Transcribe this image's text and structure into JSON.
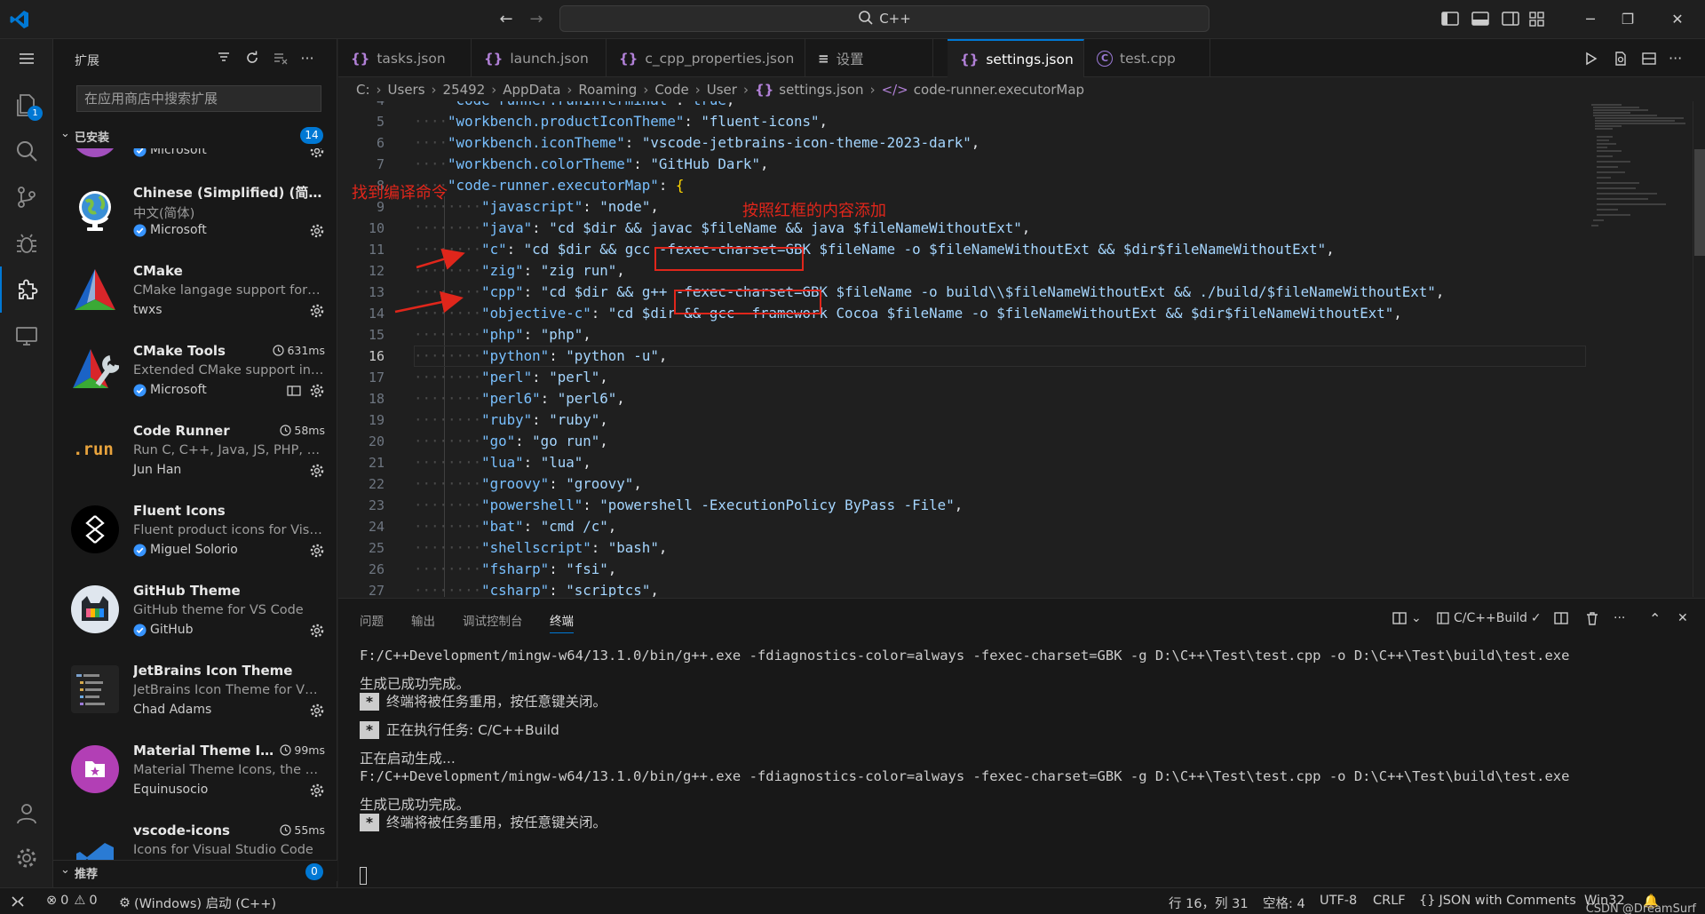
{
  "titlebar": {
    "command_center": "C++"
  },
  "activity": {
    "explorer_badge": "1"
  },
  "sidebar": {
    "title": "扩展",
    "search_placeholder": "在应用商店中搜索扩展",
    "installed_label": "已安装",
    "installed_count": "14",
    "recommended_label": "推荐",
    "recommended_count": "0",
    "extensions": [
      {
        "name": "",
        "desc": "",
        "publisher": "Microsoft",
        "verified": true,
        "time": "",
        "icon": "purple-partial-icon"
      },
      {
        "name": "Chinese (Simplified) (简体中文) Language Pack",
        "desc": "中文(简体)",
        "publisher": "Microsoft",
        "verified": true,
        "time": "",
        "icon": "globe-icon"
      },
      {
        "name": "CMake",
        "desc": "CMake langage support for Visual Studio Code",
        "publisher": "twxs",
        "verified": false,
        "time": "",
        "icon": "cmake-icon"
      },
      {
        "name": "CMake Tools",
        "desc": "Extended CMake support in Visual Studio Code",
        "publisher": "Microsoft",
        "verified": true,
        "time": "631ms",
        "icon": "cmake-tools-icon"
      },
      {
        "name": "Code Runner",
        "desc": "Run C, C++, Java, JS, PHP, Python, Perl, Ruby",
        "publisher": "Jun Han",
        "verified": false,
        "time": "58ms",
        "icon": "run-icon"
      },
      {
        "name": "Fluent Icons",
        "desc": "Fluent product icons for Visual Studio Code",
        "publisher": "Miguel Solorio",
        "verified": true,
        "time": "",
        "icon": "fluent-icon"
      },
      {
        "name": "GitHub Theme",
        "desc": "GitHub theme for VS Code",
        "publisher": "GitHub",
        "verified": true,
        "time": "",
        "icon": "github-theme-icon"
      },
      {
        "name": "JetBrains Icon Theme",
        "desc": "JetBrains Icon Theme for VS Code",
        "publisher": "Chad Adams",
        "verified": false,
        "time": "",
        "icon": "jetbrains-icon"
      },
      {
        "name": "Material Theme Icons",
        "desc": "Material Theme Icons, the most epic icons",
        "publisher": "Equinusocio",
        "verified": false,
        "time": "99ms",
        "icon": "material-icon"
      },
      {
        "name": "vscode-icons",
        "desc": "Icons for Visual Studio Code",
        "publisher": "",
        "verified": false,
        "time": "55ms",
        "icon": "vscode-icons-icon"
      }
    ]
  },
  "tabs": [
    {
      "label": "tasks.json",
      "icon": "{}",
      "active": false
    },
    {
      "label": "launch.json",
      "icon": "{}",
      "active": false
    },
    {
      "label": "c_cpp_properties.json",
      "icon": "{}",
      "active": false
    },
    {
      "label": "设置",
      "icon": "≡",
      "active": false
    },
    {
      "label": "settings.json",
      "icon": "{}",
      "active": true,
      "dirty": true
    },
    {
      "label": "test.cpp",
      "icon": "C",
      "active": false
    }
  ],
  "breadcrumb": [
    "C:",
    "Users",
    "25492",
    "AppData",
    "Roaming",
    "Code",
    "User",
    "settings.json",
    "code-runner.executorMap"
  ],
  "editor": {
    "first_line": 4,
    "current_line": 16,
    "lines": [
      {
        "indent": 1,
        "key": "code-runner.runInTerminal",
        "value": "true",
        "kind": "bool",
        "trail": ","
      },
      {
        "indent": 1,
        "key": "workbench.productIconTheme",
        "value": "fluent-icons",
        "kind": "str",
        "trail": ","
      },
      {
        "indent": 1,
        "key": "workbench.iconTheme",
        "value": "vscode-jetbrains-icon-theme-2023-dark",
        "kind": "str",
        "trail": ","
      },
      {
        "indent": 1,
        "key": "workbench.colorTheme",
        "value": "GitHub Dark",
        "kind": "str",
        "trail": ","
      },
      {
        "indent": 1,
        "key": "code-runner.executorMap",
        "value": "{",
        "kind": "brace",
        "trail": ""
      },
      {
        "indent": 2,
        "key": "javascript",
        "value": "node",
        "kind": "str",
        "trail": ","
      },
      {
        "indent": 2,
        "key": "java",
        "value": "cd $dir && javac $fileName && java $fileNameWithoutExt",
        "kind": "str",
        "trail": ","
      },
      {
        "indent": 2,
        "key": "c",
        "value": "cd $dir && gcc -fexec-charset=GBK $fileName -o $fileNameWithoutExt && $dir$fileNameWithoutExt",
        "kind": "str",
        "trail": ","
      },
      {
        "indent": 2,
        "key": "zig",
        "value": "zig run",
        "kind": "str",
        "trail": ","
      },
      {
        "indent": 2,
        "key": "cpp",
        "value": "cd $dir && g++ -fexec-charset=GBK $fileName -o build\\\\$fileNameWithoutExt && ./build/$fileNameWithoutExt",
        "kind": "str",
        "trail": ","
      },
      {
        "indent": 2,
        "key": "objective-c",
        "value": "cd $dir && gcc -framework Cocoa $fileName -o $fileNameWithoutExt && $dir$fileNameWithoutExt",
        "kind": "str",
        "trail": ","
      },
      {
        "indent": 2,
        "key": "php",
        "value": "php",
        "kind": "str",
        "trail": ","
      },
      {
        "indent": 2,
        "key": "python",
        "value": "python -u",
        "kind": "str",
        "trail": ","
      },
      {
        "indent": 2,
        "key": "perl",
        "value": "perl",
        "kind": "str",
        "trail": ","
      },
      {
        "indent": 2,
        "key": "perl6",
        "value": "perl6",
        "kind": "str",
        "trail": ","
      },
      {
        "indent": 2,
        "key": "ruby",
        "value": "ruby",
        "kind": "str",
        "trail": ","
      },
      {
        "indent": 2,
        "key": "go",
        "value": "go run",
        "kind": "str",
        "trail": ","
      },
      {
        "indent": 2,
        "key": "lua",
        "value": "lua",
        "kind": "str",
        "trail": ","
      },
      {
        "indent": 2,
        "key": "groovy",
        "value": "groovy",
        "kind": "str",
        "trail": ","
      },
      {
        "indent": 2,
        "key": "powershell",
        "value": "powershell -ExecutionPolicy ByPass -File",
        "kind": "str",
        "trail": ","
      },
      {
        "indent": 2,
        "key": "bat",
        "value": "cmd /c",
        "kind": "str",
        "trail": ","
      },
      {
        "indent": 2,
        "key": "shellscript",
        "value": "bash",
        "kind": "str",
        "trail": ","
      },
      {
        "indent": 2,
        "key": "fsharp",
        "value": "fsi",
        "kind": "str",
        "trail": ","
      },
      {
        "indent": 2,
        "key": "csharp",
        "value": "scriptcs",
        "kind": "str",
        "trail": ","
      }
    ]
  },
  "annotations": {
    "find_cmd": "找到编译命令",
    "add_per_box": "按照红框的内容添加",
    "highlight": "-fexec-charset=GBK"
  },
  "panel": {
    "tabs": [
      "问题",
      "输出",
      "调试控制台",
      "终端"
    ],
    "active_tab": "终端",
    "task_name": "C/C++Build",
    "terminal_lines": [
      {
        "text": "F:/C++Development/mingw-w64/13.1.0/bin/g++.exe -fdiagnostics-color=always -fexec-charset=GBK -g D:\\C++\\Test\\test.cpp -o D:\\C++\\Test\\build\\test.exe",
        "star": false,
        "cjk": false
      },
      {
        "text": "",
        "star": false,
        "cjk": false
      },
      {
        "text": "生成已成功完成。",
        "star": false,
        "cjk": true
      },
      {
        "text": "终端将被任务重用，按任意键关闭。",
        "star": true,
        "cjk": true
      },
      {
        "text": "",
        "star": false,
        "cjk": false
      },
      {
        "text": "正在执行任务: C/C++Build",
        "star": true,
        "cjk": true
      },
      {
        "text": "",
        "star": false,
        "cjk": false
      },
      {
        "text": "正在启动生成...",
        "star": false,
        "cjk": true
      },
      {
        "text": "F:/C++Development/mingw-w64/13.1.0/bin/g++.exe -fdiagnostics-color=always -fexec-charset=GBK -g D:\\C++\\Test\\test.cpp -o D:\\C++\\Test\\build\\test.exe",
        "star": false,
        "cjk": false
      },
      {
        "text": "",
        "star": false,
        "cjk": false
      },
      {
        "text": "生成已成功完成。",
        "star": false,
        "cjk": true
      },
      {
        "text": "终端将被任务重用，按任意键关闭。",
        "star": true,
        "cjk": true
      }
    ]
  },
  "statusbar": {
    "errors": "0",
    "warnings": "0",
    "debug_target": "(Windows) 启动 (C++)",
    "position": "行 16，列 31",
    "spaces": "空格: 4",
    "encoding": "UTF-8",
    "eol": "CRLF",
    "language": "JSON with Comments",
    "platform": "Win32",
    "watermark": "CSDN @DreamSurf"
  },
  "colors": {
    "accent": "#0078d4",
    "annotation": "#e0261b",
    "json_key": "#79c0ff",
    "json_string": "#a5d6ff"
  }
}
